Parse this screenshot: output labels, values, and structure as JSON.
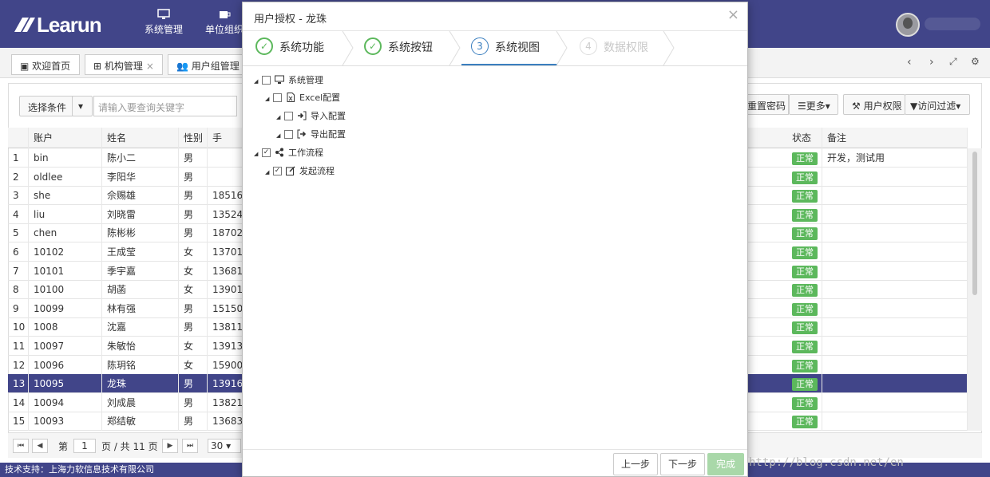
{
  "app": {
    "logo_text": "Learun"
  },
  "nav": [
    {
      "label": "系统管理"
    },
    {
      "label": "单位组织"
    }
  ],
  "tabs": [
    {
      "label": "欢迎首页"
    },
    {
      "label": "机构管理"
    },
    {
      "label": "用户组管理"
    }
  ],
  "toolbar": {
    "filter_label": "选择条件",
    "search_placeholder": "请输入要查询关键字",
    "reset_password": "重置密码",
    "more": "更多",
    "user_permission": "用户权限",
    "access_filter": "访问过滤"
  },
  "grid": {
    "headers": [
      "账户",
      "姓名",
      "性别",
      "手",
      "状态",
      "备注"
    ],
    "rows": [
      {
        "n": "1",
        "account": "bin",
        "name": "陈小二",
        "gender": "男",
        "phone": "",
        "status": "正常",
        "note": "开发，测试用"
      },
      {
        "n": "2",
        "account": "oldlee",
        "name": "李阳华",
        "gender": "男",
        "phone": "",
        "status": "正常",
        "note": ""
      },
      {
        "n": "3",
        "account": "she",
        "name": "佘赐雄",
        "gender": "男",
        "phone": "18516",
        "status": "正常",
        "note": ""
      },
      {
        "n": "4",
        "account": "liu",
        "name": "刘晓雷",
        "gender": "男",
        "phone": "13524",
        "status": "正常",
        "note": ""
      },
      {
        "n": "5",
        "account": "chen",
        "name": "陈彬彬",
        "gender": "男",
        "phone": "18702",
        "status": "正常",
        "note": ""
      },
      {
        "n": "6",
        "account": "10102",
        "name": "王成莹",
        "gender": "女",
        "phone": "13701",
        "status": "正常",
        "note": ""
      },
      {
        "n": "7",
        "account": "10101",
        "name": "季宇嘉",
        "gender": "女",
        "phone": "13681",
        "status": "正常",
        "note": ""
      },
      {
        "n": "8",
        "account": "10100",
        "name": "胡菡",
        "gender": "女",
        "phone": "13901",
        "status": "正常",
        "note": ""
      },
      {
        "n": "9",
        "account": "10099",
        "name": "林有强",
        "gender": "男",
        "phone": "15150",
        "status": "正常",
        "note": ""
      },
      {
        "n": "10",
        "account": "1008",
        "name": "沈嘉",
        "gender": "男",
        "phone": "13811",
        "status": "正常",
        "note": ""
      },
      {
        "n": "11",
        "account": "10097",
        "name": "朱敏怡",
        "gender": "女",
        "phone": "13913",
        "status": "正常",
        "note": ""
      },
      {
        "n": "12",
        "account": "10096",
        "name": "陈玥铭",
        "gender": "女",
        "phone": "15900",
        "status": "正常",
        "note": ""
      },
      {
        "n": "13",
        "account": "10095",
        "name": "龙珠",
        "gender": "男",
        "phone": "13916",
        "status": "正常",
        "note": ""
      },
      {
        "n": "14",
        "account": "10094",
        "name": "刘成晨",
        "gender": "男",
        "phone": "13821",
        "status": "正常",
        "note": ""
      },
      {
        "n": "15",
        "account": "10093",
        "name": "郑结敏",
        "gender": "男",
        "phone": "13683",
        "status": "正常",
        "note": ""
      }
    ]
  },
  "pager": {
    "prefix": "第",
    "page": "1",
    "suffix": "页 / 共 11 页",
    "page_size": "30"
  },
  "footer": {
    "text": "技术支持：上海力软信息技术有限公司"
  },
  "watermark": "http://blog.csdn.net/en",
  "modal": {
    "title": "用户授权 - 龙珠",
    "steps": [
      {
        "num": "✓",
        "label": "系统功能",
        "state": "done"
      },
      {
        "num": "✓",
        "label": "系统按钮",
        "state": "done"
      },
      {
        "num": "3",
        "label": "系统视图",
        "state": "active"
      },
      {
        "num": "4",
        "label": "数据权限",
        "state": "todo"
      }
    ],
    "tree": [
      {
        "label": "系统管理",
        "checked": false
      },
      {
        "label": "Excel配置",
        "checked": false
      },
      {
        "label": "导入配置",
        "checked": false
      },
      {
        "label": "导出配置",
        "checked": false
      },
      {
        "label": "工作流程",
        "checked": true
      },
      {
        "label": "发起流程",
        "checked": true
      }
    ],
    "buttons": {
      "prev": "上一步",
      "next": "下一步",
      "finish": "完成"
    }
  },
  "colors": {
    "brand": "#414589",
    "status_green": "#5cb85c",
    "active_step": "#3a7ebf"
  }
}
